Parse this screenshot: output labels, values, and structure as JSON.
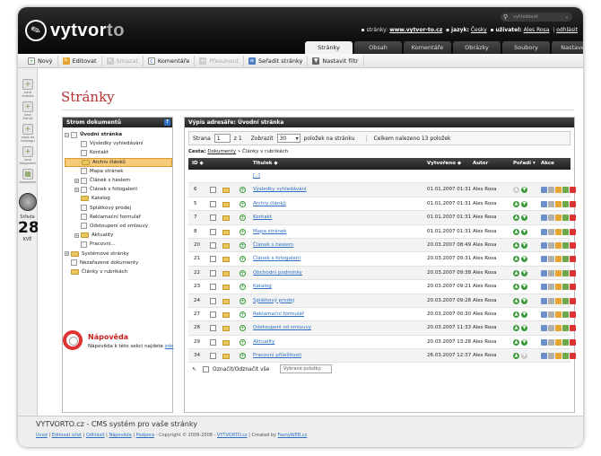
{
  "app": {
    "logo_prefix": "vyt",
    "logo_main": "vor",
    "logo_suffix": "to"
  },
  "header": {
    "search_placeholder": "vyhledávat",
    "site_label": "stránky:",
    "site_value": "www.vytvor-to.cz",
    "lang_label": "jazyk:",
    "lang_value": "Česky",
    "user_label": "uživatel:",
    "user_value": "Ales Rosa",
    "logout": "odhlásit"
  },
  "tabs": [
    "Stránky",
    "Obsah",
    "Komentáře",
    "Obrázky",
    "Soubory",
    "Nastavení"
  ],
  "toolbar": [
    "Nový",
    "Editovat",
    "Smazat",
    "Komentáře",
    "Přesunout",
    "Seřadit stránky",
    "Nastavit filtr"
  ],
  "toolbar_disabled": [
    false,
    false,
    true,
    false,
    true,
    false,
    false
  ],
  "sidebar": {
    "buttons": [
      "nová stránka",
      "nový článek",
      "zápis do katalogu",
      "nová fotogalerie",
      "fotogalerie"
    ],
    "day_name": "Středa",
    "day_num": "28",
    "day_short": "KVĚ"
  },
  "page_title": "Stránky",
  "tree": {
    "title": "Strom dokumentů",
    "help": "?",
    "items": [
      {
        "label": "Úvodní stránka",
        "type": "doc",
        "exp": "−",
        "indent": 0,
        "bold": true
      },
      {
        "label": "Výsledky vyhledávání",
        "type": "doc",
        "indent": 1
      },
      {
        "label": "Kontakt",
        "type": "doc",
        "indent": 1
      },
      {
        "label": "Archiv článků",
        "type": "fold",
        "indent": 1,
        "sel": true
      },
      {
        "label": "Mapa stránek",
        "type": "doc",
        "indent": 1
      },
      {
        "label": "Článek s heslem",
        "type": "doc",
        "exp": "+",
        "indent": 1
      },
      {
        "label": "Článek s fotogalerií",
        "type": "doc",
        "exp": "+",
        "indent": 1
      },
      {
        "label": "Katalog",
        "type": "fold",
        "indent": 1
      },
      {
        "label": "Splátkový prodej",
        "type": "doc",
        "indent": 1
      },
      {
        "label": "Reklamační formulář",
        "type": "doc",
        "indent": 1
      },
      {
        "label": "Odstoupení od smlouvy",
        "type": "doc",
        "indent": 1
      },
      {
        "label": "Aktuality",
        "type": "fold",
        "exp": "+",
        "indent": 1
      },
      {
        "label": "Pracovní...",
        "type": "doc",
        "indent": 1
      },
      {
        "label": "Systémové stránky",
        "type": "fold",
        "exp": "+",
        "indent": 0
      },
      {
        "label": "Nezařazené dokumenty",
        "type": "doc",
        "indent": 0
      },
      {
        "label": "Články v rubrikách",
        "type": "fold",
        "indent": 0
      }
    ]
  },
  "list": {
    "title": "Výpis adresáře: Úvodní stránka",
    "pager": {
      "page_label": "Strana",
      "page_value": "1",
      "of_label": "z 1",
      "show_label": "Zobrazit",
      "show_value": "30",
      "per_page": "položek na stránku",
      "total": "Celkem nalezeno 13 položek"
    },
    "crumb_label": "Cesta:",
    "crumb_link": "Dokumenty",
    "crumb_rest": "» Články v rubrikách",
    "headers": {
      "id": "ID ◆",
      "title": "Titulek ◆",
      "created": "Vytvořeno ◆",
      "author": "Autor",
      "order": "Pořadí ▾",
      "actions": "Akce"
    },
    "up_row": "[..]",
    "rows": [
      {
        "id": "6",
        "title": "Výsledky vyhledávání",
        "date": "01.01.2007 01:31",
        "author": "Ales Rosa"
      },
      {
        "id": "5",
        "title": "Archiv článků",
        "date": "01.01.2007 01:31",
        "author": "Ales Rosa"
      },
      {
        "id": "7",
        "title": "Kontakt",
        "date": "01.01.2007 01:31",
        "author": "Ales Rosa"
      },
      {
        "id": "8",
        "title": "Mapa stránek",
        "date": "01.01.2007 01:31",
        "author": "Ales Rosa"
      },
      {
        "id": "20",
        "title": "Článek s heslem",
        "date": "20.03.2007 08:49",
        "author": "Ales Rosa"
      },
      {
        "id": "21",
        "title": "Článek s fotogalerií",
        "date": "20.03.2007 09:31",
        "author": "Ales Rosa"
      },
      {
        "id": "22",
        "title": "Obchodní podmínky",
        "date": "20.03.2007 09:38",
        "author": "Ales Rosa"
      },
      {
        "id": "23",
        "title": "Katalog",
        "date": "20.03.2007 09:21",
        "author": "Ales Rosa"
      },
      {
        "id": "24",
        "title": "Splátkový prodej",
        "date": "20.03.2007 09:28",
        "author": "Ales Rosa"
      },
      {
        "id": "27",
        "title": "Reklamační formulář",
        "date": "20.03.2007 00:30",
        "author": "Ales Rosa"
      },
      {
        "id": "28",
        "title": "Odstoupení od smlouvy",
        "date": "20.03.2007 11:33",
        "author": "Ales Rosa"
      },
      {
        "id": "29",
        "title": "Aktuality",
        "date": "20.03.2007 13:28",
        "author": "Ales Rosa"
      },
      {
        "id": "34",
        "title": "Pracovní příležitosti",
        "date": "26.03.2007 12:37",
        "author": "Ales Rosa"
      }
    ],
    "footer": {
      "arrow": "↖",
      "mark_all": "Označit/Odznačit vše",
      "selected": "Vybrané položky:"
    }
  },
  "help": {
    "title": "Nápověda",
    "text": "Nápověda k této sekci najdete",
    "link": "zde"
  },
  "footer": {
    "title": "VYTVORTO.cz - CMS systém pro vaše stránky",
    "links": [
      "Úvod",
      "Editovat účet",
      "Odhlásit",
      "Nápověda",
      "Podpora"
    ],
    "copyright": "Copyright © 2006-2008 -",
    "brand": "VYTVORTO.cz",
    "created": "| Created by",
    "creator": "FasnyWEB.cz"
  },
  "colors": {
    "accent": "#b8312f",
    "link": "#2d6fc4",
    "green": "#3a9a3a",
    "selected": "#f6c97b"
  }
}
